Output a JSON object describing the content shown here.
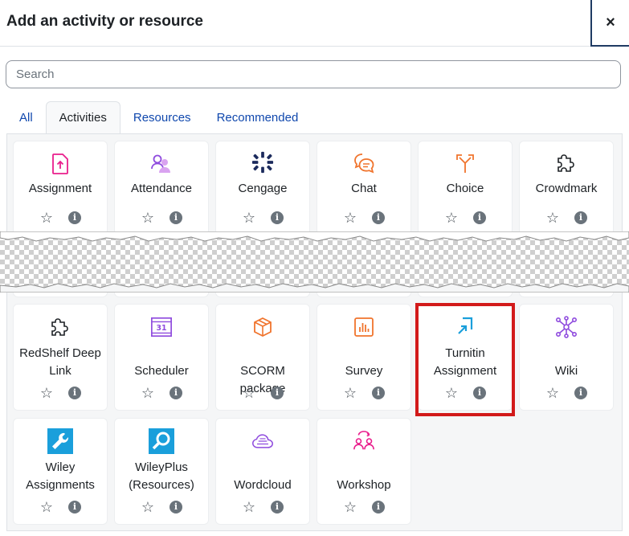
{
  "header": {
    "title": "Add an activity or resource",
    "close_label": "×"
  },
  "search": {
    "placeholder": "Search"
  },
  "tabs": [
    {
      "label": "All"
    },
    {
      "label": "Activities"
    },
    {
      "label": "Resources"
    },
    {
      "label": "Recommended"
    }
  ],
  "colors": {
    "accent": "#0f47ad",
    "highlight": "#d21a1a",
    "assignment_pink": "#e91e8c",
    "choice_orange": "#f0742d",
    "purple": "#8f4bde",
    "wiley_blue": "#1a9fdb"
  },
  "cards_top": [
    {
      "label": "Assignment",
      "icon": "upload-document-icon"
    },
    {
      "label": "Attendance",
      "icon": "people-icon"
    },
    {
      "label": "Cengage",
      "icon": "cengage-logo-icon"
    },
    {
      "label": "Chat",
      "icon": "chat-bubbles-icon"
    },
    {
      "label": "Choice",
      "icon": "split-arrows-icon"
    },
    {
      "label": "Crowdmark",
      "icon": "puzzle-icon"
    }
  ],
  "cards_mid": [
    {
      "label_line1": "RedShelf Deep",
      "label_line2": "Link",
      "icon": "puzzle-icon"
    },
    {
      "label_line1": "",
      "label_line2": "Scheduler",
      "icon": "calendar-icon",
      "calendar_day": "31"
    },
    {
      "label_line1": "",
      "label_line2": "SCORM package",
      "icon": "package-box-icon"
    },
    {
      "label_line1": "",
      "label_line2": "Survey",
      "icon": "bar-chart-icon"
    },
    {
      "label_line1": "Turnitin",
      "label_line2": "Assignment",
      "icon": "turnitin-icon"
    },
    {
      "label_line1": "",
      "label_line2": "Wiki",
      "icon": "network-nodes-icon"
    }
  ],
  "cards_bottom": [
    {
      "label_line1": "Wiley",
      "label_line2": "Assignments",
      "icon": "wrench-icon"
    },
    {
      "label_line1": "WileyPlus",
      "label_line2": "(Resources)",
      "icon": "magnifier-icon"
    },
    {
      "label_line1": "",
      "label_line2": "Wordcloud",
      "icon": "cloud-icon"
    },
    {
      "label_line1": "",
      "label_line2": "Workshop",
      "icon": "people-exchange-icon"
    }
  ],
  "card_actions": {
    "star": "☆",
    "info": "i"
  }
}
